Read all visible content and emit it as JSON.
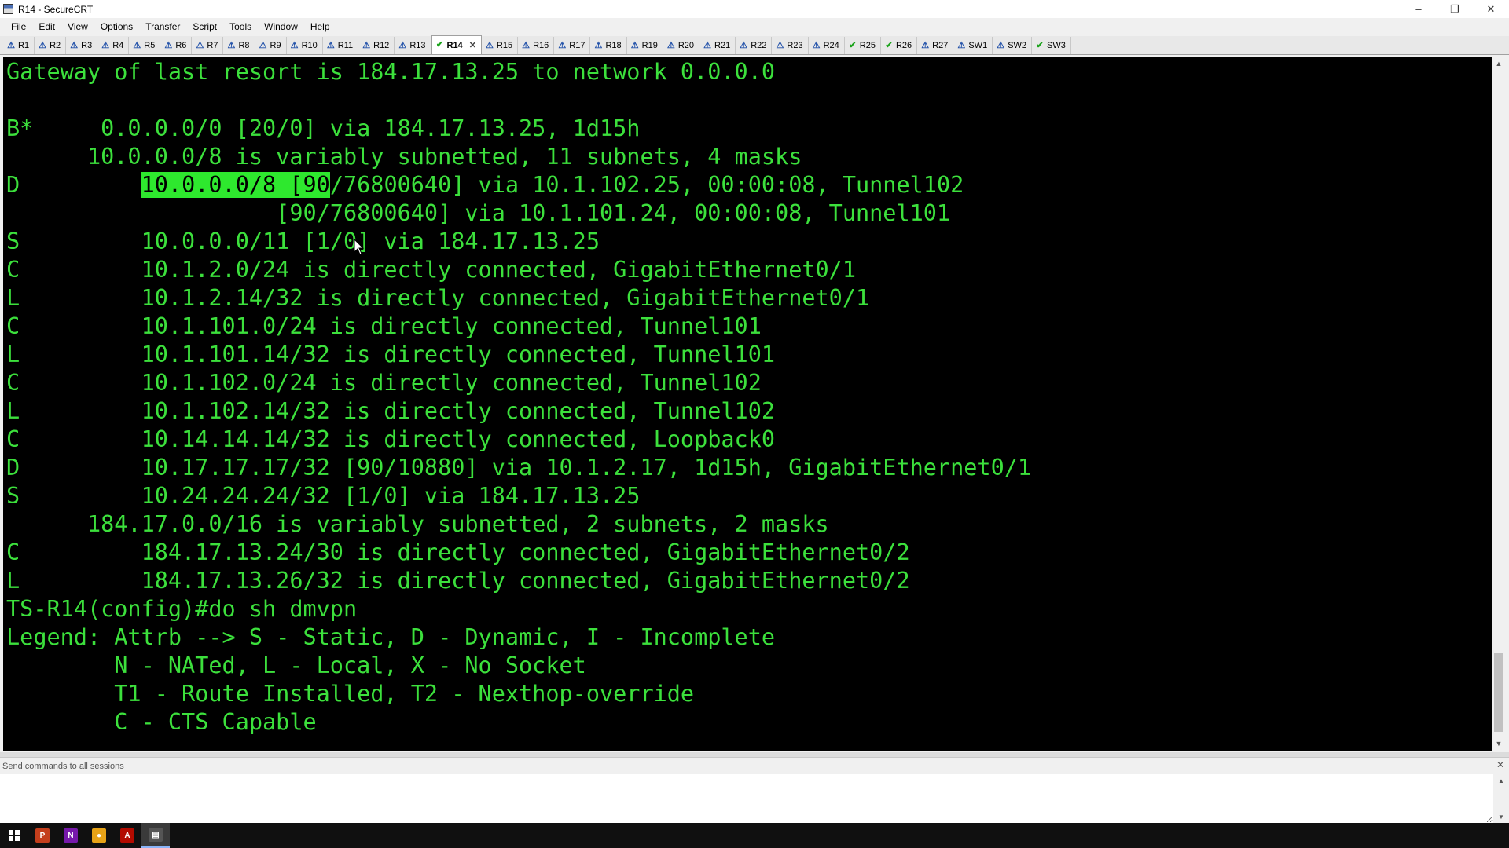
{
  "window": {
    "title": "R14 - SecureCRT",
    "minimize": "–",
    "restore": "❐",
    "close": "✕"
  },
  "menu": [
    "File",
    "Edit",
    "View",
    "Options",
    "Transfer",
    "Script",
    "Tools",
    "Window",
    "Help"
  ],
  "tabs": [
    {
      "label": "R1",
      "status": "warn"
    },
    {
      "label": "R2",
      "status": "warn"
    },
    {
      "label": "R3",
      "status": "warn"
    },
    {
      "label": "R4",
      "status": "warn"
    },
    {
      "label": "R5",
      "status": "warn"
    },
    {
      "label": "R6",
      "status": "warn"
    },
    {
      "label": "R7",
      "status": "warn"
    },
    {
      "label": "R8",
      "status": "warn"
    },
    {
      "label": "R9",
      "status": "warn"
    },
    {
      "label": "R10",
      "status": "warn"
    },
    {
      "label": "R11",
      "status": "warn"
    },
    {
      "label": "R12",
      "status": "warn"
    },
    {
      "label": "R13",
      "status": "warn"
    },
    {
      "label": "R14",
      "status": "ok",
      "active": true
    },
    {
      "label": "R15",
      "status": "warn"
    },
    {
      "label": "R16",
      "status": "warn"
    },
    {
      "label": "R17",
      "status": "warn"
    },
    {
      "label": "R18",
      "status": "warn"
    },
    {
      "label": "R19",
      "status": "warn"
    },
    {
      "label": "R20",
      "status": "warn"
    },
    {
      "label": "R21",
      "status": "warn"
    },
    {
      "label": "R22",
      "status": "warn"
    },
    {
      "label": "R23",
      "status": "warn"
    },
    {
      "label": "R24",
      "status": "warn"
    },
    {
      "label": "R25",
      "status": "ok"
    },
    {
      "label": "R26",
      "status": "ok"
    },
    {
      "label": "R27",
      "status": "warn"
    },
    {
      "label": "SW1",
      "status": "warn"
    },
    {
      "label": "SW2",
      "status": "warn"
    },
    {
      "label": "SW3",
      "status": "ok"
    }
  ],
  "terminal": {
    "lines": [
      {
        "pre": "Gateway of last resort is 184.17.13.25 to network 0.0.0.0",
        "hl": "",
        "post": ""
      },
      {
        "pre": "",
        "hl": "",
        "post": ""
      },
      {
        "pre": "B*     0.0.0.0/0 [20/0] via 184.17.13.25, 1d15h",
        "hl": "",
        "post": ""
      },
      {
        "pre": "      10.0.0.0/8 is variably subnetted, 11 subnets, 4 masks",
        "hl": "",
        "post": ""
      },
      {
        "pre": "D         ",
        "hl": "10.0.0.0/8 [90",
        "post": "/76800640] via 10.1.102.25, 00:00:08, Tunnel102"
      },
      {
        "pre": "                    [90/76800640] via 10.1.101.24, 00:00:08, Tunnel101",
        "hl": "",
        "post": ""
      },
      {
        "pre": "S         10.0.0.0/11 [1/0] via 184.17.13.25",
        "hl": "",
        "post": ""
      },
      {
        "pre": "C         10.1.2.0/24 is directly connected, GigabitEthernet0/1",
        "hl": "",
        "post": ""
      },
      {
        "pre": "L         10.1.2.14/32 is directly connected, GigabitEthernet0/1",
        "hl": "",
        "post": ""
      },
      {
        "pre": "C         10.1.101.0/24 is directly connected, Tunnel101",
        "hl": "",
        "post": ""
      },
      {
        "pre": "L         10.1.101.14/32 is directly connected, Tunnel101",
        "hl": "",
        "post": ""
      },
      {
        "pre": "C         10.1.102.0/24 is directly connected, Tunnel102",
        "hl": "",
        "post": ""
      },
      {
        "pre": "L         10.1.102.14/32 is directly connected, Tunnel102",
        "hl": "",
        "post": ""
      },
      {
        "pre": "C         10.14.14.14/32 is directly connected, Loopback0",
        "hl": "",
        "post": ""
      },
      {
        "pre": "D         10.17.17.17/32 [90/10880] via 10.1.2.17, 1d15h, GigabitEthernet0/1",
        "hl": "",
        "post": ""
      },
      {
        "pre": "S         10.24.24.24/32 [1/0] via 184.17.13.25",
        "hl": "",
        "post": ""
      },
      {
        "pre": "      184.17.0.0/16 is variably subnetted, 2 subnets, 2 masks",
        "hl": "",
        "post": ""
      },
      {
        "pre": "C         184.17.13.24/30 is directly connected, GigabitEthernet0/2",
        "hl": "",
        "post": ""
      },
      {
        "pre": "L         184.17.13.26/32 is directly connected, GigabitEthernet0/2",
        "hl": "",
        "post": ""
      },
      {
        "pre": "TS-R14(config)#do sh dmvpn",
        "hl": "",
        "post": ""
      },
      {
        "pre": "Legend: Attrb --> S - Static, D - Dynamic, I - Incomplete",
        "hl": "",
        "post": ""
      },
      {
        "pre": "        N - NATed, L - Local, X - No Socket",
        "hl": "",
        "post": ""
      },
      {
        "pre": "        T1 - Route Installed, T2 - Nexthop-override",
        "hl": "",
        "post": ""
      },
      {
        "pre": "        C - CTS Capable",
        "hl": "",
        "post": ""
      }
    ]
  },
  "command_window": {
    "label": "Send commands to all sessions",
    "close": "✕"
  },
  "taskbar": {
    "apps": [
      {
        "icon": "powerpoint-icon",
        "glyph": "P",
        "color": "#c43e1c"
      },
      {
        "icon": "onenote-icon",
        "glyph": "N",
        "color": "#7719aa"
      },
      {
        "icon": "chrome-icon",
        "glyph": "●",
        "color": "#e8a317"
      },
      {
        "icon": "acrobat-icon",
        "glyph": "A",
        "color": "#b30b00"
      },
      {
        "icon": "securecrt-icon",
        "glyph": "▤",
        "color": "#555555"
      }
    ]
  },
  "colors": {
    "terminal_bg": "#000000",
    "terminal_fg": "#3ce03c",
    "highlight": "#2ee82e"
  }
}
